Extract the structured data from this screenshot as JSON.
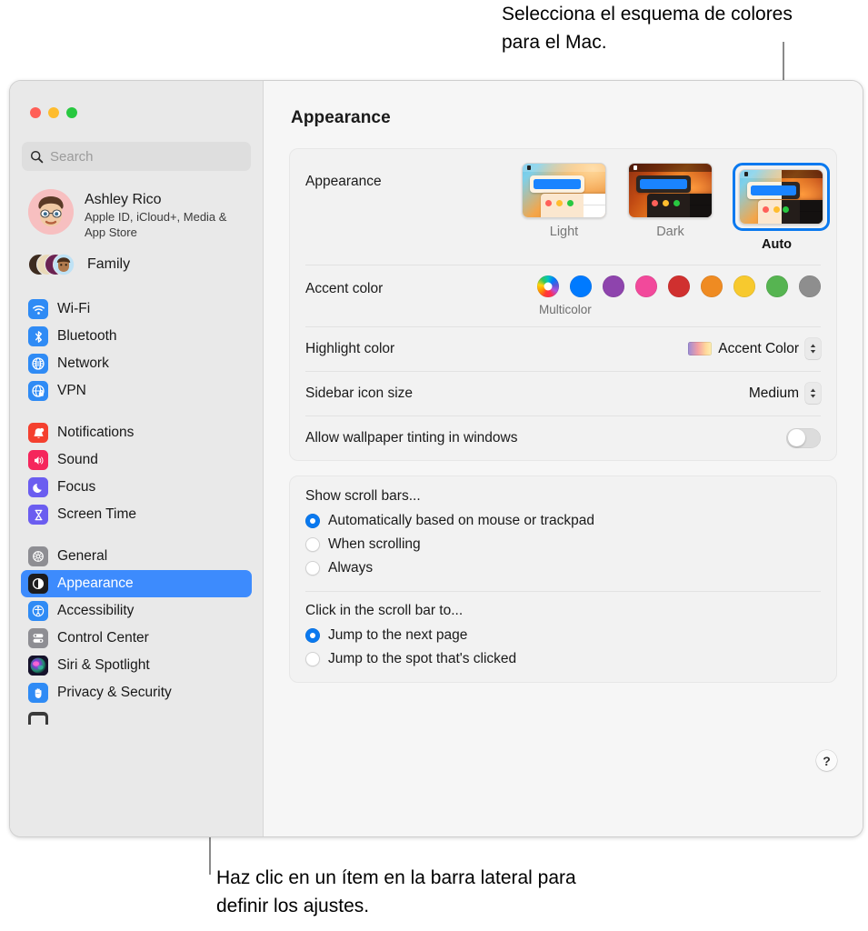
{
  "callouts": {
    "top": "Selecciona el esquema de colores para el Mac.",
    "bottom": "Haz clic en un ítem en la barra lateral para definir los ajustes."
  },
  "window": {
    "title": "Appearance"
  },
  "sidebar": {
    "search": {
      "placeholder": "Search",
      "value": ""
    },
    "account": {
      "name": "Ashley Rico",
      "subtitle": "Apple ID, iCloud+, Media & App Store"
    },
    "family": {
      "label": "Family"
    },
    "groups": [
      {
        "items": [
          {
            "label": "Wi-Fi",
            "icon": "wifi-icon",
            "selected": false
          },
          {
            "label": "Bluetooth",
            "icon": "bluetooth-icon",
            "selected": false
          },
          {
            "label": "Network",
            "icon": "globe-icon",
            "selected": false
          },
          {
            "label": "VPN",
            "icon": "vpn-globe-icon",
            "selected": false
          }
        ]
      },
      {
        "items": [
          {
            "label": "Notifications",
            "icon": "bell-icon",
            "selected": false
          },
          {
            "label": "Sound",
            "icon": "speaker-icon",
            "selected": false
          },
          {
            "label": "Focus",
            "icon": "moon-icon",
            "selected": false
          },
          {
            "label": "Screen Time",
            "icon": "hourglass-icon",
            "selected": false
          }
        ]
      },
      {
        "items": [
          {
            "label": "General",
            "icon": "gear-icon",
            "selected": false
          },
          {
            "label": "Appearance",
            "icon": "appearance-icon",
            "selected": true
          },
          {
            "label": "Accessibility",
            "icon": "accessibility-icon",
            "selected": false
          },
          {
            "label": "Control Center",
            "icon": "control-center-icon",
            "selected": false
          },
          {
            "label": "Siri & Spotlight",
            "icon": "siri-icon",
            "selected": false
          },
          {
            "label": "Privacy & Security",
            "icon": "hand-icon",
            "selected": false
          }
        ]
      }
    ]
  },
  "main": {
    "appearance": {
      "label": "Appearance",
      "options": [
        {
          "caption": "Light",
          "selected": false
        },
        {
          "caption": "Dark",
          "selected": false
        },
        {
          "caption": "Auto",
          "selected": true
        }
      ]
    },
    "accent": {
      "label": "Accent color",
      "multicolor_label": "Multicolor",
      "swatches": [
        {
          "name": "multicolor",
          "color": "multicolor",
          "selected": true
        },
        {
          "name": "blue",
          "color": "#007aff",
          "selected": false
        },
        {
          "name": "purple",
          "color": "#8e44ad",
          "selected": false
        },
        {
          "name": "pink",
          "color": "#f2499b",
          "selected": false
        },
        {
          "name": "red",
          "color": "#d0302f",
          "selected": false
        },
        {
          "name": "orange",
          "color": "#ef8b22",
          "selected": false
        },
        {
          "name": "yellow",
          "color": "#f7c92e",
          "selected": false
        },
        {
          "name": "green",
          "color": "#56b451",
          "selected": false
        },
        {
          "name": "graphite",
          "color": "#8e8e8e",
          "selected": false
        }
      ]
    },
    "highlight": {
      "label": "Highlight color",
      "value": "Accent Color"
    },
    "sidebar_icon_size": {
      "label": "Sidebar icon size",
      "value": "Medium"
    },
    "wallpaper_tinting": {
      "label": "Allow wallpaper tinting in windows",
      "enabled": false
    },
    "show_scroll_bars": {
      "title": "Show scroll bars...",
      "options": [
        {
          "label": "Automatically based on mouse or trackpad",
          "selected": true
        },
        {
          "label": "When scrolling",
          "selected": false
        },
        {
          "label": "Always",
          "selected": false
        }
      ]
    },
    "click_scroll_bar": {
      "title": "Click in the scroll bar to...",
      "options": [
        {
          "label": "Jump to the next page",
          "selected": true
        },
        {
          "label": "Jump to the spot that's clicked",
          "selected": false
        }
      ]
    },
    "help_label": "?"
  },
  "colors": {
    "accent_blue": "#3d8bfd",
    "selection_blue": "#0a79ef",
    "sidebar_bg": "#e9e9e9",
    "panel_bg": "#f6f6f6",
    "card_bg": "#f2f2f2"
  }
}
